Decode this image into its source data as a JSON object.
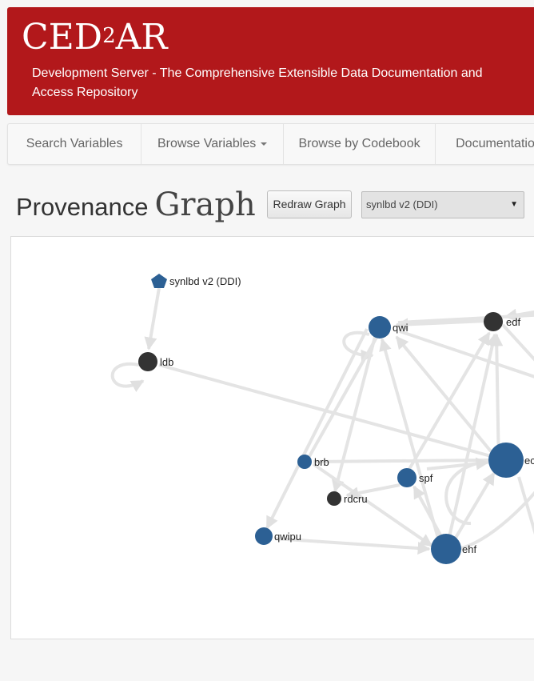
{
  "header": {
    "logo_main": "CED",
    "logo_sup": "2",
    "logo_end": "AR",
    "subtitle": "Development Server - The Comprehensive Extensible Data Documentation and Access Repository"
  },
  "nav": {
    "items": [
      {
        "label": "Search Variables"
      },
      {
        "label": "Browse Variables",
        "dropdown": true
      },
      {
        "label": "Browse by Codebook"
      },
      {
        "label": "Documentation"
      }
    ]
  },
  "page": {
    "title_part1": "Provenance",
    "title_part2": "Graph",
    "redraw_label": "Redraw Graph",
    "selected_codebook": "synlbd v2 (DDI)"
  },
  "graph": {
    "colors": {
      "codebook": "#2c6094",
      "blue": "#2c6094",
      "dark": "#333333",
      "edge": "#e4e4e4"
    },
    "nodes": [
      {
        "id": "synlbd",
        "label": "synlbd v2 (DDI)",
        "kind": "codebook"
      },
      {
        "id": "ldb",
        "label": "ldb",
        "kind": "dark"
      },
      {
        "id": "qwi",
        "label": "qwi",
        "kind": "blue"
      },
      {
        "id": "edf",
        "label": "edf",
        "kind": "dark"
      },
      {
        "id": "brb",
        "label": "brb",
        "kind": "blue"
      },
      {
        "id": "spf",
        "label": "spf",
        "kind": "blue"
      },
      {
        "id": "rdcru",
        "label": "rdcru",
        "kind": "dark"
      },
      {
        "id": "qwipu",
        "label": "qwipu",
        "kind": "blue"
      },
      {
        "id": "ehf",
        "label": "ehf",
        "kind": "blue"
      },
      {
        "id": "ecf",
        "label": "ec",
        "kind": "blue"
      }
    ]
  }
}
